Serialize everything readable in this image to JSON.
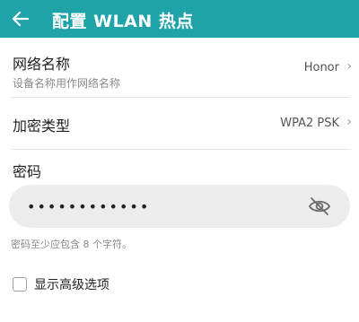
{
  "header": {
    "title": "配置 WLAN 热点",
    "back_icon": "back-arrow-icon",
    "background_color": "#1fa3a9"
  },
  "network_name": {
    "label": "网络名称",
    "subtitle": "设备名称用作网络名称",
    "value": "Honor"
  },
  "security": {
    "label": "加密类型",
    "value": "WPA2 PSK"
  },
  "password": {
    "label": "密码",
    "value": "••••••••••••",
    "hint": "密码至少应包含 8 个字符。",
    "toggle_icon": "eye-off-icon"
  },
  "advanced": {
    "label": "显示高级选项",
    "checked": false
  }
}
